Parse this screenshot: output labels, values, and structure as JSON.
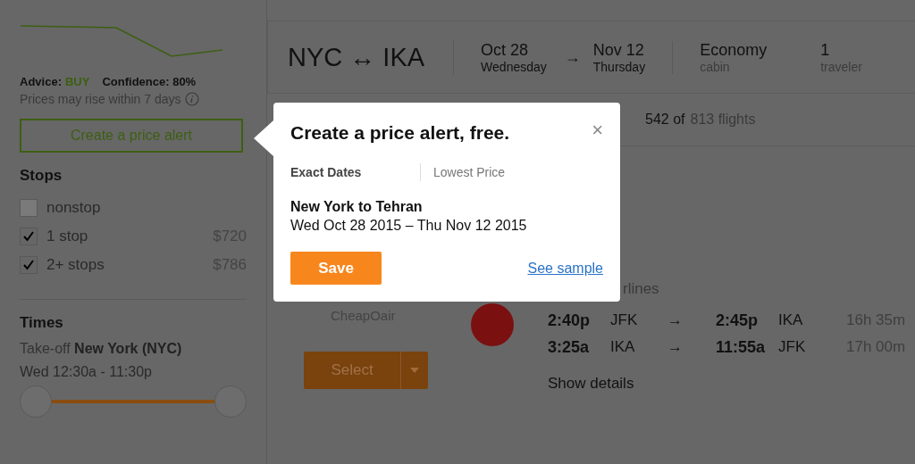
{
  "sidebar": {
    "advice_label": "Advice:",
    "advice_value": "BUY",
    "confidence": "Confidence: 80%",
    "note": "Prices may rise within 7 days",
    "alert_button": "Create a price alert",
    "stops": {
      "title": "Stops",
      "options": [
        {
          "label": "nonstop",
          "checked": false
        },
        {
          "label": "1 stop",
          "price": "$720",
          "checked": true
        },
        {
          "label": "2+ stops",
          "price": "$786",
          "checked": true
        }
      ]
    },
    "times": {
      "title": "Times",
      "takeoff": "Take-off **New York (NYC)**",
      "range": "Wed 12:30a - 11:30p",
      "slider": {
        "level": 1
      }
    }
  },
  "search": {
    "route": "NYC ↔ IKA",
    "departure": {
      "date": "Oct 28",
      "day": "Wednesday"
    },
    "arrow": "→",
    "return": {
      "date": "Nov 12",
      "day": "Thursday"
    },
    "cabin": {
      "value": "Economy",
      "label": "cabin"
    },
    "travelers": {
      "value": "1",
      "label": "traveler"
    }
  },
  "results": {
    "shown": "542 of",
    "total": "813 flights"
  },
  "result": {
    "provider": "CheapOair",
    "select_button": "Select",
    "airline": "rlines",
    "legs": [
      {
        "depart_time": "2:40p",
        "depart_airport": "JFK",
        "arrow": "→",
        "arrive_time": "2:45p",
        "arrive_airport": "IKA",
        "duration": "16h 35m"
      },
      {
        "depart_time": "3:25a",
        "depart_airport": "IKA",
        "arrow": "→",
        "arrive_time": "11:55a",
        "arrive_airport": "JFK",
        "duration": "17h 00m"
      }
    ],
    "details_link": "Show details"
  },
  "popup": {
    "title": "Create a price alert, free.",
    "close": "×",
    "tabs": [
      {
        "label": "Exact Dates",
        "selected": true
      },
      {
        "label": "Lowest Price",
        "selected": false
      }
    ],
    "route": "New York to Tehran",
    "dates": "Wed Oct 28 2015 – Thu Nov 12 2015",
    "save_button": "Save",
    "sample_link": "See sample"
  }
}
